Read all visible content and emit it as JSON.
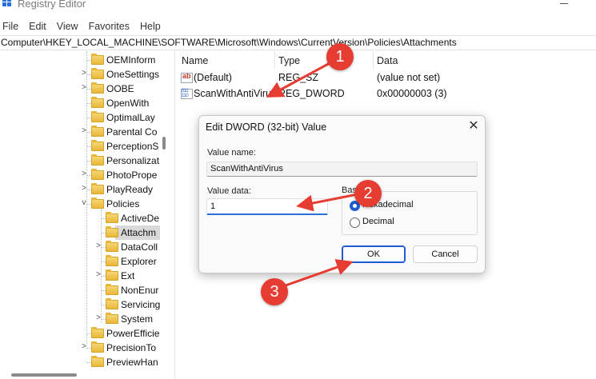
{
  "window": {
    "title": "Registry Editor"
  },
  "menu": [
    "File",
    "Edit",
    "View",
    "Favorites",
    "Help"
  ],
  "address": "Computer\\HKEY_LOCAL_MACHINE\\SOFTWARE\\Microsoft\\Windows\\CurrentVersion\\Policies\\Attachments",
  "tree": [
    {
      "label": "OEMInform",
      "chevron": "",
      "indent": 0
    },
    {
      "label": "OneSettings",
      "chevron": ">",
      "indent": 0
    },
    {
      "label": "OOBE",
      "chevron": ">",
      "indent": 0
    },
    {
      "label": "OpenWith",
      "chevron": "",
      "indent": 0
    },
    {
      "label": "OptimalLay",
      "chevron": "",
      "indent": 0
    },
    {
      "label": "Parental Co",
      "chevron": ">",
      "indent": 0
    },
    {
      "label": "PerceptionS",
      "chevron": "",
      "indent": 0
    },
    {
      "label": "Personalizat",
      "chevron": "",
      "indent": 0
    },
    {
      "label": "PhotoPrope",
      "chevron": ">",
      "indent": 0
    },
    {
      "label": "PlayReady",
      "chevron": ">",
      "indent": 0
    },
    {
      "label": "Policies",
      "chevron": "v",
      "indent": 0
    },
    {
      "label": "ActiveDe",
      "chevron": "",
      "indent": 1
    },
    {
      "label": "Attachm",
      "chevron": "",
      "indent": 1,
      "selected": true
    },
    {
      "label": "DataColl",
      "chevron": ">",
      "indent": 1
    },
    {
      "label": "Explorer",
      "chevron": "",
      "indent": 1
    },
    {
      "label": "Ext",
      "chevron": ">",
      "indent": 1
    },
    {
      "label": "NonEnur",
      "chevron": "",
      "indent": 1
    },
    {
      "label": "Servicing",
      "chevron": "",
      "indent": 1
    },
    {
      "label": "System",
      "chevron": ">",
      "indent": 1
    },
    {
      "label": "PowerEfficie",
      "chevron": "",
      "indent": 0
    },
    {
      "label": "PrecisionTo",
      "chevron": ">",
      "indent": 0
    },
    {
      "label": "PreviewHan",
      "chevron": "",
      "indent": 0
    }
  ],
  "values": {
    "headers": {
      "name": "Name",
      "type": "Type",
      "data": "Data"
    },
    "rows": [
      {
        "icon": "string-value-icon",
        "name": "(Default)",
        "type": "REG_SZ",
        "data": "(value not set)"
      },
      {
        "icon": "dword-value-icon",
        "name": "ScanWithAntiVirus",
        "type": "REG_DWORD",
        "data": "0x00000003 (3)"
      }
    ]
  },
  "dialog": {
    "title": "Edit DWORD (32-bit) Value",
    "close_glyph": "✕",
    "value_name_label": "Value name:",
    "value_name": "ScanWithAntiVirus",
    "value_data_label": "Value data:",
    "value_data": "1",
    "base_label": "Base",
    "radios": [
      {
        "label": "Hexadecimal",
        "checked": true
      },
      {
        "label": "Decimal",
        "checked": false
      }
    ],
    "ok": "OK",
    "cancel": "Cancel"
  },
  "annotations": {
    "badges": [
      "1",
      "2",
      "3"
    ],
    "color": "#e63c32"
  }
}
